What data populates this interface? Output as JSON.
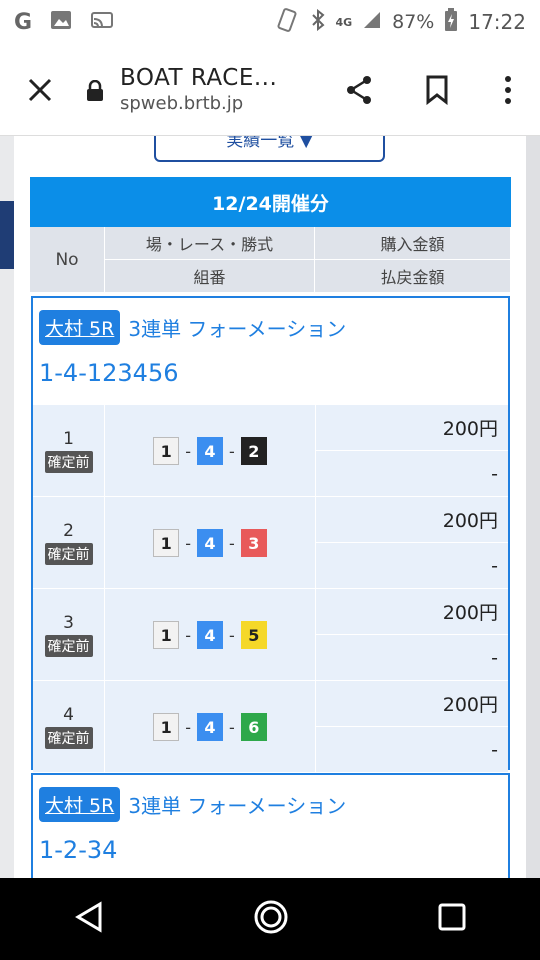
{
  "status_bar": {
    "left_icons": [
      "google-icon",
      "image-icon",
      "cast-icon"
    ],
    "g_label": "G",
    "network": "4G",
    "battery": "87%",
    "time": "17:22"
  },
  "url_bar": {
    "title": "BOAT RACE...",
    "domain": "spweb.brtb.jp"
  },
  "page": {
    "top_button_label": "実績一覧 ▼",
    "header": "12/24開催分",
    "columns": {
      "no": "No",
      "race": "場・レース・勝式",
      "purchase": "購入金額",
      "combo": "組番",
      "payout": "払戻金額"
    }
  },
  "cards": [
    {
      "venue": "大村 5R",
      "bet_type": "3連単 フォーメーション",
      "combo": "1-4-123456",
      "rows": [
        {
          "no": "1",
          "status": "確定前",
          "boats": [
            "1",
            "4",
            "2"
          ],
          "buy": "200円",
          "payout": "-"
        },
        {
          "no": "2",
          "status": "確定前",
          "boats": [
            "1",
            "4",
            "3"
          ],
          "buy": "200円",
          "payout": "-"
        },
        {
          "no": "3",
          "status": "確定前",
          "boats": [
            "1",
            "4",
            "5"
          ],
          "buy": "200円",
          "payout": "-"
        },
        {
          "no": "4",
          "status": "確定前",
          "boats": [
            "1",
            "4",
            "6"
          ],
          "buy": "200円",
          "payout": "-"
        }
      ]
    },
    {
      "venue": "大村 5R",
      "bet_type": "3連単 フォーメーション",
      "combo": "1-2-34"
    }
  ],
  "boat_colors": {
    "1": {
      "bg": "#f2f2f2",
      "fg": "#222"
    },
    "2": {
      "bg": "#222222",
      "fg": "#fff"
    },
    "3": {
      "bg": "#e85a5a",
      "fg": "#fff"
    },
    "4": {
      "bg": "#3b8ef0",
      "fg": "#fff"
    },
    "5": {
      "bg": "#f5d829",
      "fg": "#222"
    },
    "6": {
      "bg": "#2ea84a",
      "fg": "#fff"
    }
  }
}
